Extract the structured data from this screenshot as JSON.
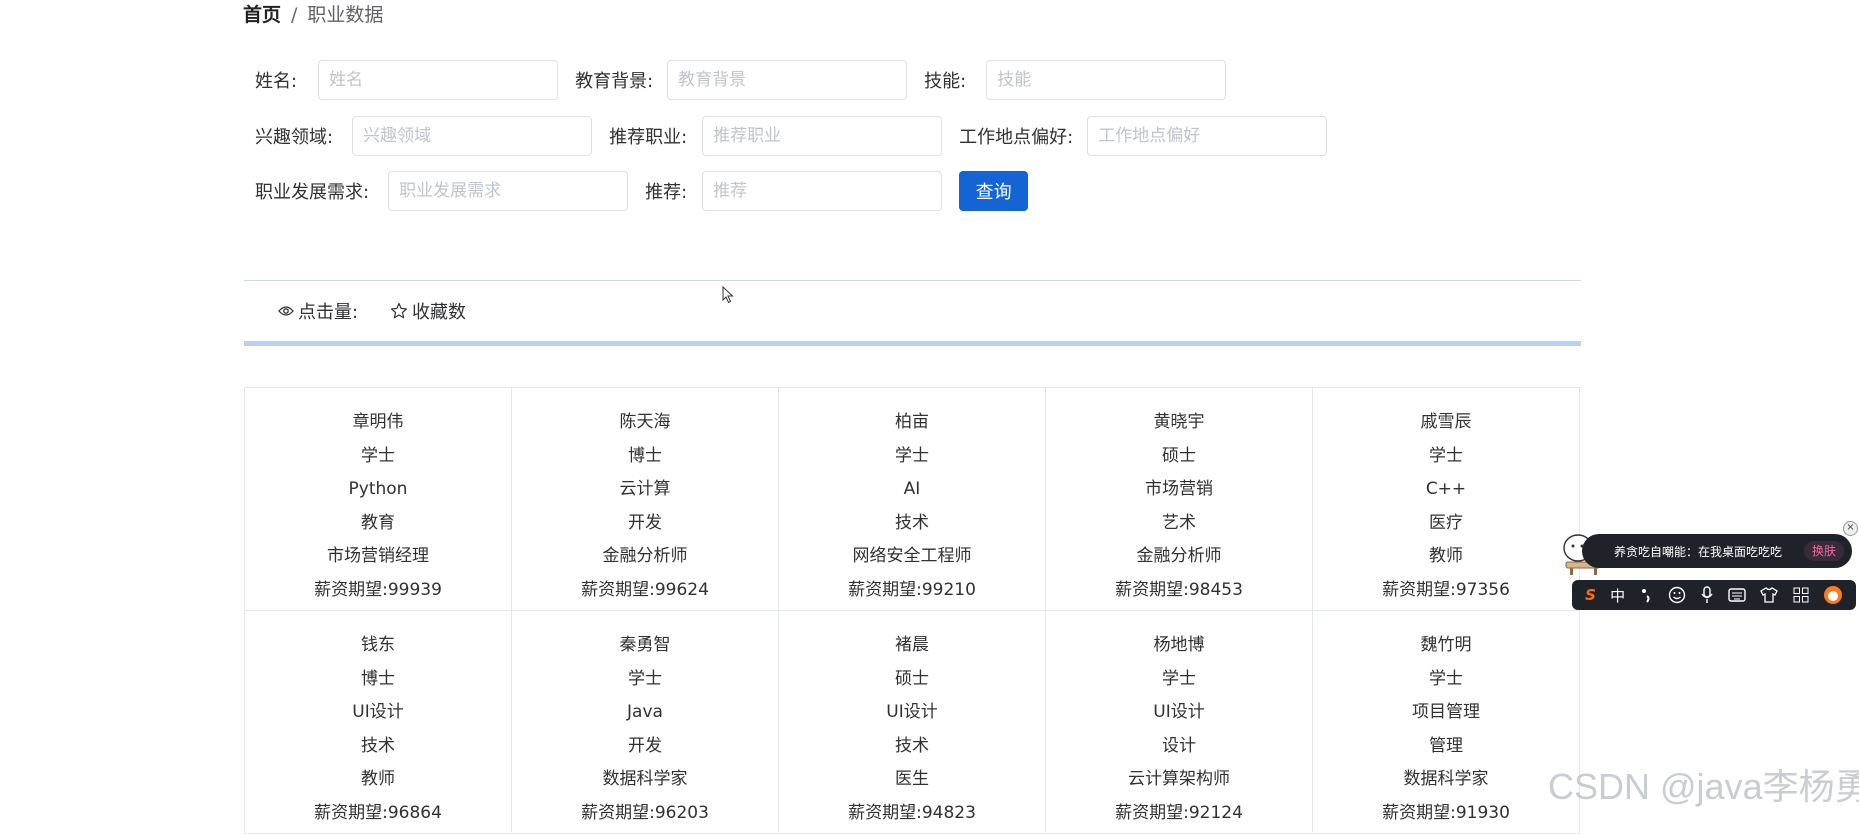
{
  "breadcrumb": {
    "home": "首页",
    "separator": "/",
    "current": "职业数据"
  },
  "search": {
    "name_label": "姓名:",
    "name_placeholder": "姓名",
    "education_label": "教育背景:",
    "education_placeholder": "教育背景",
    "skills_label": "技能:",
    "skills_placeholder": "技能",
    "interest_label": "兴趣领域:",
    "interest_placeholder": "兴趣领域",
    "career_label": "推荐职业:",
    "career_placeholder": "推荐职业",
    "location_label": "工作地点偏好:",
    "location_placeholder": "工作地点偏好",
    "development_label": "职业发展需求:",
    "development_placeholder": "职业发展需求",
    "recommend_label": "推荐:",
    "recommend_placeholder": "推荐",
    "search_button": "查询"
  },
  "sort": {
    "clicks_label": "点击量:",
    "favorites_label": "收藏数"
  },
  "cards": [
    {
      "name": "章明伟",
      "education": "学士",
      "skill": "Python",
      "interest": "教育",
      "career": "市场营销经理",
      "salary": "薪资期望:99939"
    },
    {
      "name": "陈天海",
      "education": "博士",
      "skill": "云计算",
      "interest": "开发",
      "career": "金融分析师",
      "salary": "薪资期望:99624"
    },
    {
      "name": "柏亩",
      "education": "学士",
      "skill": "AI",
      "interest": "技术",
      "career": "网络安全工程师",
      "salary": "薪资期望:99210"
    },
    {
      "name": "黄晓宇",
      "education": "硕士",
      "skill": "市场营销",
      "interest": "艺术",
      "career": "金融分析师",
      "salary": "薪资期望:98453"
    },
    {
      "name": "戚雪辰",
      "education": "学士",
      "skill": "C++",
      "interest": "医疗",
      "career": "教师",
      "salary": "薪资期望:97356"
    },
    {
      "name": "钱东",
      "education": "博士",
      "skill": "UI设计",
      "interest": "技术",
      "career": "教师",
      "salary": "薪资期望:96864"
    },
    {
      "name": "秦勇智",
      "education": "学士",
      "skill": "Java",
      "interest": "开发",
      "career": "数据科学家",
      "salary": "薪资期望:96203"
    },
    {
      "name": "褚晨",
      "education": "硕士",
      "skill": "UI设计",
      "interest": "技术",
      "career": "医生",
      "salary": "薪资期望:94823"
    },
    {
      "name": "杨地博",
      "education": "学士",
      "skill": "UI设计",
      "interest": "设计",
      "career": "云计算架构师",
      "salary": "薪资期望:92124"
    },
    {
      "name": "魏竹明",
      "education": "学士",
      "skill": "项目管理",
      "interest": "管理",
      "career": "数据科学家",
      "salary": "薪资期望:91930"
    }
  ],
  "ime": {
    "tip_text": "养贪吃自嘲能：在我桌面吃吃吃",
    "skin_label": "换肤",
    "close": "×",
    "logo": "S",
    "mode": "中",
    "toolbar_icons": [
      "logo-icon",
      "chinese-mode",
      "punctuation-icon",
      "emoji-icon",
      "microphone-icon",
      "keyboard-icon",
      "skin-icon",
      "apps-grid-icon",
      "mascot-icon"
    ]
  },
  "watermark": "CSDN @java李杨勇"
}
